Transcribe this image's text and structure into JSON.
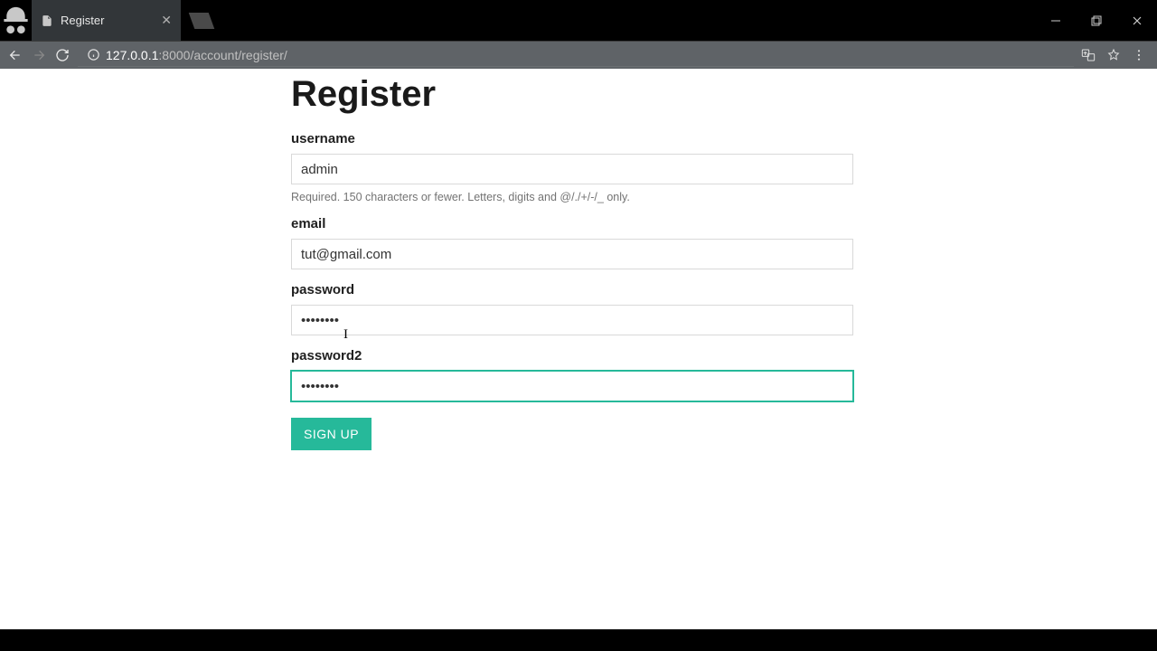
{
  "browser": {
    "tab_title": "Register",
    "url_host": "127.0.0.1",
    "url_port": ":8000",
    "url_path": "/account/register/"
  },
  "page": {
    "heading": "Register",
    "fields": {
      "username": {
        "label": "username",
        "value": "admin",
        "help": "Required. 150 characters or fewer. Letters, digits and @/./+/-/_ only."
      },
      "email": {
        "label": "email",
        "value": "tut@gmail.com"
      },
      "password": {
        "label": "password",
        "value": "••••••••"
      },
      "password2": {
        "label": "password2",
        "value": "••••••••"
      }
    },
    "submit_label": "SIGN UP"
  }
}
